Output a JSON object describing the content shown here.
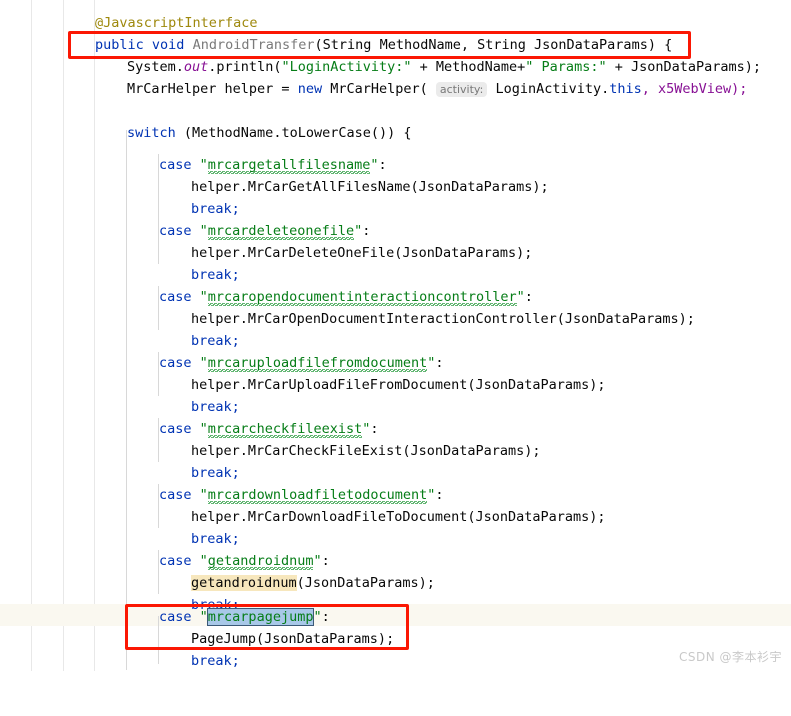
{
  "editor": {
    "app": "IntelliJ IDEA Java source editor",
    "language": "Java",
    "background_color": "#ffffff",
    "caret_line_color": "#faf8f0",
    "annotation_box_color": "#fb1703",
    "selection_color": "#a8c8e8",
    "warning_highlight_color": "#f7e7bd",
    "gutter_line_color": "#e8e8e8",
    "indent_guide_color": "#d8d8d8"
  },
  "syntax_colors": {
    "keyword": "#0033b3",
    "annotation": "#9e880d",
    "method_declaration": "#7a7a7a",
    "string": "#067d17",
    "static_field": "#871094",
    "identifier": "#080808",
    "squiggle": "#2f9e44"
  },
  "code": {
    "annotation": "@JavascriptInterface",
    "signature": {
      "modifier": "public",
      "return_type": "void",
      "name": "AndroidTransfer",
      "param1_type": "String",
      "param1_name": "MethodName",
      "param2_type": "String",
      "param2_name": "JsonDataParams",
      "open_brace": ") {"
    },
    "println": {
      "prefix": "System.",
      "field": "out",
      "call": ".println(",
      "str1": "\"LoginActivity:\"",
      "op1": " + MethodName+",
      "str2": "\" Params:\"",
      "op2": " + JsonDataParams);"
    },
    "helper_decl": {
      "type": "MrCarHelper",
      "var": " helper = ",
      "kw_new": "new",
      "ctor": " MrCarHelper( ",
      "hint": "activity:",
      "arg1": " LoginActivity.",
      "kw_this": "this",
      "arg2": ", x5WebView);"
    },
    "switch_stmt": {
      "kw": "switch",
      "expr": " (MethodName.toLowerCase()) {"
    },
    "cases": [
      {
        "label": "mrcargetallfilesname",
        "body": "helper.MrCarGetAllFilesName(JsonDataParams);",
        "break": "break;"
      },
      {
        "label": "mrcardeleteonefile",
        "body": "helper.MrCarDeleteOneFile(JsonDataParams);",
        "break": "break;"
      },
      {
        "label": "mrcaropendocumentinteractioncontroller",
        "body": "helper.MrCarOpenDocumentInteractionController(JsonDataParams);",
        "break": "break;"
      },
      {
        "label": "mrcaruploadfilefromdocument",
        "body": "helper.MrCarUploadFileFromDocument(JsonDataParams);",
        "break": "break;"
      },
      {
        "label": "mrcarcheckfileexist",
        "body": "helper.MrCarCheckFileExist(JsonDataParams);",
        "break": "break;"
      },
      {
        "label": "mrcardownloadfiletodocument",
        "body": "helper.MrCarDownloadFileToDocument(JsonDataParams);",
        "break": "break;"
      }
    ],
    "case_getandroidnum": {
      "kw": "case",
      "label": "getandroidnum",
      "call_highlighted": "getandroidnum",
      "call_rest": "(JsonDataParams);",
      "break": "break;"
    },
    "case_pagejump": {
      "kw": "case",
      "label_selected": "mrcarpagejump",
      "body": "PageJump(JsonDataParams);",
      "break": "break;"
    },
    "kw_case": "case",
    "kw_break": "break;",
    "quote": "\"",
    "colon": ":"
  },
  "watermark": {
    "text": "CSDN @李本衫宇"
  }
}
